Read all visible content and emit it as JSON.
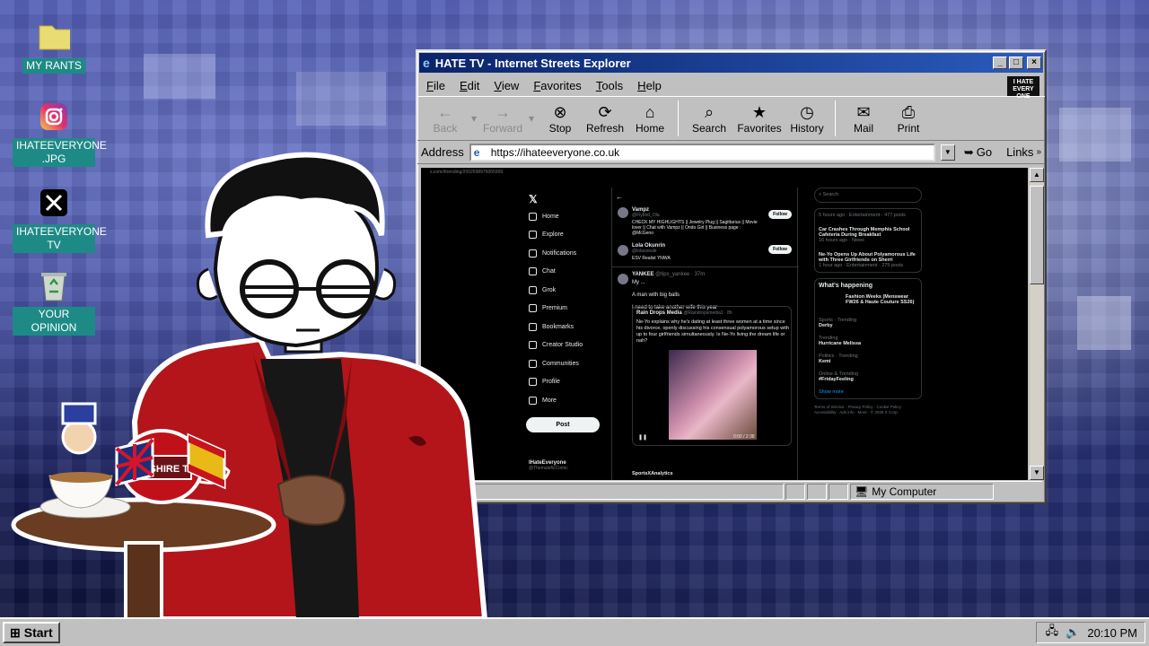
{
  "desktop": {
    "icons": [
      {
        "label": "MY RANTS",
        "icon": "folder-icon"
      },
      {
        "label": "IHATEEVERYONE .JPG",
        "icon": "instagram-icon"
      },
      {
        "label": "IHATEEVERYONE TV",
        "icon": "x-icon"
      },
      {
        "label": "YOUR OPINION",
        "icon": "recycle-bin-icon"
      }
    ]
  },
  "window": {
    "title": "HATE TV - Internet Streets Explorer",
    "logo_text": "I HATE EVERY ONE",
    "menu": [
      "File",
      "Edit",
      "View",
      "Favorites",
      "Tools",
      "Help"
    ],
    "toolbar": [
      "Back",
      "Forward",
      "Stop",
      "Refresh",
      "Home",
      "Search",
      "Favorites",
      "History",
      "Mail",
      "Print"
    ],
    "address_label": "Address",
    "address_value": "https://ihateeveryone.co.uk",
    "go_label": "Go",
    "links_label": "Links",
    "status_zone": "My Computer"
  },
  "x_page": {
    "url": "x.com/i/trending/2002698976065909",
    "nav": [
      "Home",
      "Explore",
      "Notifications",
      "Chat",
      "Grok",
      "Premium",
      "Bookmarks",
      "Creator Studio",
      "Communities",
      "Profile",
      "More"
    ],
    "post_button": "Post",
    "account_name": "IHateEveryone",
    "account_handle": "@ThemaleficComic",
    "suggest": [
      {
        "name": "Vampz",
        "handle": "@Flybird_Ola",
        "bio": "CHECK MY HIGHLIGHTS || Jewelry Plug || Sagittarius || Movie lover || Chat with Vampz || Ondo Girl || Business page : @McGeno",
        "action": "Follow"
      },
      {
        "name": "Lola Okunrin",
        "handle": "@lolaoseule",
        "bio": "ESV Realist YNWA",
        "action": "Follow"
      }
    ],
    "tweet": {
      "author": "YANKEE",
      "handle": "@tips_yankee · 37m",
      "lines": [
        "My ...",
        "A man with big balls",
        "I need to take another wife this year"
      ],
      "quote_author": "Rain Drops Media",
      "quote_handle": "@Raindropsmedia1 · 8h",
      "quote_text": "Ne-Yo explains why he's dating at least three women at a time since his divorce, openly discussing his consensual polyamorous setup with up to four girlfriends simultaneously. Is Ne-Yo living the dream life or nah?",
      "video_time": "0:00 / 2:38"
    },
    "next_author": "SportsXAnalytics",
    "sidebar": {
      "search_placeholder": "Search",
      "trends_top": [
        {
          "meta": "5 hours ago · Entertainment · 477 posts",
          "title": ""
        },
        {
          "meta": "",
          "title": "Car Crashes Through Memphis School Cafeteria During Breakfast"
        },
        {
          "meta": "16 hours ago · News",
          "title": ""
        },
        {
          "meta": "",
          "title": "Ne-Yo Opens Up About Polyamorous Life with Three Girlfriends on Sherri"
        },
        {
          "meta": "1 hour ago · Entertainment · 275 posts",
          "title": ""
        }
      ],
      "whats_happening": "What's happening",
      "happening": [
        {
          "meta": "",
          "title": "Fashion Weeks (Menswear FW26 & Haute Couture SS26)"
        },
        {
          "meta": "Sports · Trending",
          "title": "Derby"
        },
        {
          "meta": "Trending",
          "title": "Hurricane Melissa"
        },
        {
          "meta": "Politics · Trending",
          "title": "Kemi"
        },
        {
          "meta": "Online & Trending",
          "title": "#FridayFeeling"
        }
      ],
      "show_more": "Show more",
      "footer": "Terms of Service · Privacy Policy · Cookie Policy · Accessibility · Ads info · More · © 2025 X Corp."
    }
  },
  "taskbar": {
    "start_label": "Start",
    "clock": "20:10 PM"
  },
  "scene": {
    "tea_box_text": "YORKSHIRE TEA"
  },
  "colors": {
    "titlebar": "#0a246a",
    "desktop_label_bg": "#1e8a86",
    "x_background": "#000000",
    "jacket": "#b3151b"
  }
}
